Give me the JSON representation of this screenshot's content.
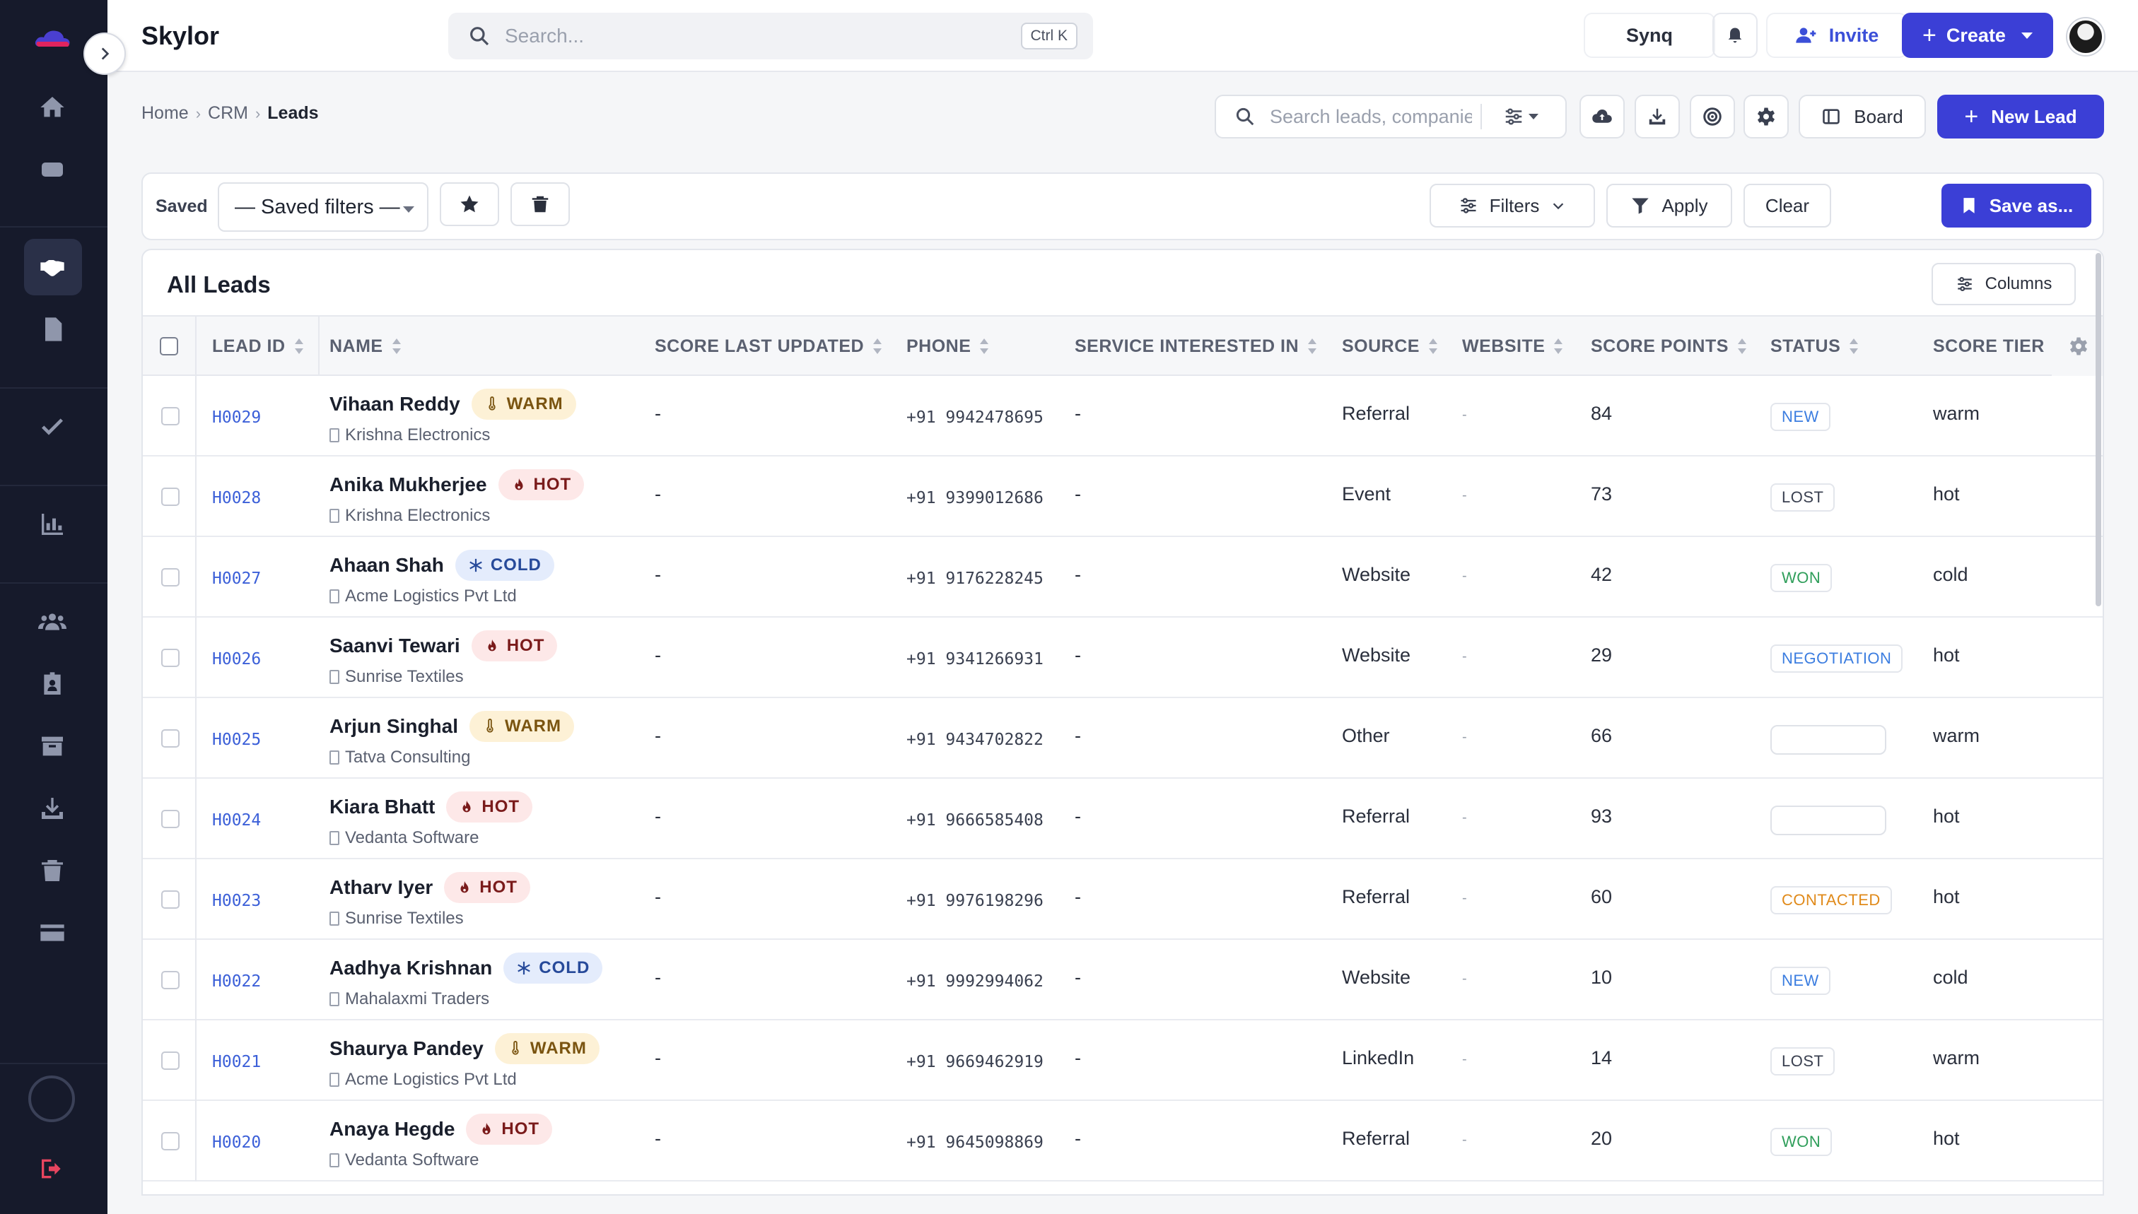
{
  "app": {
    "brand": "Skylor"
  },
  "search": {
    "placeholder": "Search...",
    "shortcut": "Ctrl K"
  },
  "header": {
    "synq_label": "Synq",
    "invite_label": "Invite",
    "create_label": "Create"
  },
  "breadcrumb": [
    "Home",
    "CRM",
    "Leads"
  ],
  "toolbar": {
    "search_placeholder": "Search leads, companies...",
    "board_label": "Board",
    "new_lead_label": "New Lead"
  },
  "filters": {
    "saved_label": "Saved",
    "saved_select": "— Saved filters —",
    "filters_label": "Filters",
    "apply_label": "Apply",
    "clear_label": "Clear",
    "save_as_label": "Save as..."
  },
  "table": {
    "title": "All Leads",
    "columns_button": "Columns",
    "headers": {
      "lead_id": "LEAD ID",
      "name": "NAME",
      "score_last_updated": "SCORE LAST UPDATED",
      "phone": "PHONE",
      "service": "SERVICE INTERESTED IN",
      "source": "SOURCE",
      "website": "WEBSITE",
      "score_points": "SCORE POINTS",
      "status": "STATUS",
      "score_tier": "SCORE TIER"
    },
    "rows": [
      {
        "id": "H0029",
        "name": "Vihaan Reddy",
        "temp": "WARM",
        "company": "Krishna Electronics",
        "updated": "-",
        "phone": "+91 9942478695",
        "service": "-",
        "source": "Referral",
        "website": "-",
        "points": "84",
        "status": "NEW",
        "tier": "warm"
      },
      {
        "id": "H0028",
        "name": "Anika Mukherjee",
        "temp": "HOT",
        "company": "Krishna Electronics",
        "updated": "-",
        "phone": "+91 9399012686",
        "service": "-",
        "source": "Event",
        "website": "-",
        "points": "73",
        "status": "LOST",
        "tier": "hot"
      },
      {
        "id": "H0027",
        "name": "Ahaan Shah",
        "temp": "COLD",
        "company": "Acme Logistics Pvt Ltd",
        "updated": "-",
        "phone": "+91 9176228245",
        "service": "-",
        "source": "Website",
        "website": "-",
        "points": "42",
        "status": "WON",
        "tier": "cold"
      },
      {
        "id": "H0026",
        "name": "Saanvi Tewari",
        "temp": "HOT",
        "company": "Sunrise Textiles",
        "updated": "-",
        "phone": "+91 9341266931",
        "service": "-",
        "source": "Website",
        "website": "-",
        "points": "29",
        "status": "NEGOTIATION",
        "tier": "hot"
      },
      {
        "id": "H0025",
        "name": "Arjun Singhal",
        "temp": "WARM",
        "company": "Tatva Consulting",
        "updated": "-",
        "phone": "+91 9434702822",
        "service": "-",
        "source": "Other",
        "website": "-",
        "points": "66",
        "status": "",
        "tier": "warm"
      },
      {
        "id": "H0024",
        "name": "Kiara Bhatt",
        "temp": "HOT",
        "company": "Vedanta Software",
        "updated": "-",
        "phone": "+91 9666585408",
        "service": "-",
        "source": "Referral",
        "website": "-",
        "points": "93",
        "status": "",
        "tier": "hot"
      },
      {
        "id": "H0023",
        "name": "Atharv Iyer",
        "temp": "HOT",
        "company": "Sunrise Textiles",
        "updated": "-",
        "phone": "+91 9976198296",
        "service": "-",
        "source": "Referral",
        "website": "-",
        "points": "60",
        "status": "CONTACTED",
        "tier": "hot"
      },
      {
        "id": "H0022",
        "name": "Aadhya Krishnan",
        "temp": "COLD",
        "company": "Mahalaxmi Traders",
        "updated": "-",
        "phone": "+91 9992994062",
        "service": "-",
        "source": "Website",
        "website": "-",
        "points": "10",
        "status": "NEW",
        "tier": "cold"
      },
      {
        "id": "H0021",
        "name": "Shaurya Pandey",
        "temp": "WARM",
        "company": "Acme Logistics Pvt Ltd",
        "updated": "-",
        "phone": "+91 9669462919",
        "service": "-",
        "source": "LinkedIn",
        "website": "-",
        "points": "14",
        "status": "LOST",
        "tier": "warm"
      },
      {
        "id": "H0020",
        "name": "Anaya Hegde",
        "temp": "HOT",
        "company": "Vedanta Software",
        "updated": "-",
        "phone": "+91 9645098869",
        "service": "-",
        "source": "Referral",
        "website": "-",
        "points": "20",
        "status": "WON",
        "tier": "hot"
      }
    ]
  },
  "colors": {
    "accent": "#3b3fd6",
    "sidebar": "#161a2b",
    "status_new": "#3b7de0",
    "status_lost": "#3a4050",
    "status_won": "#2f9e5a",
    "status_negotiation": "#3b7de0",
    "status_contacted": "#e08a1a"
  }
}
